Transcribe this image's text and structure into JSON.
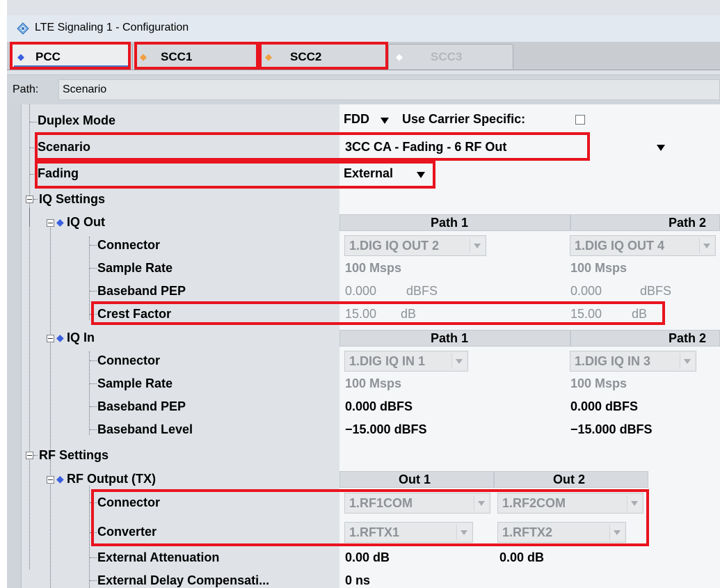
{
  "window": {
    "title": "LTE Signaling 1 - Configuration",
    "icon": "cmw-app-icon"
  },
  "tabs": [
    {
      "label": "PCC",
      "state": "active",
      "dot_color": "#3a5fe0"
    },
    {
      "label": "SCC1",
      "state": "normal",
      "dot_color": "#f0a040"
    },
    {
      "label": "SCC2",
      "state": "normal",
      "dot_color": "#f0a040"
    },
    {
      "label": "SCC3",
      "state": "disabled",
      "dot_color": "#ffffff"
    }
  ],
  "path": {
    "label": "Path:",
    "value": "Scenario"
  },
  "config": {
    "duplex_mode": {
      "label": "Duplex Mode",
      "value": "FDD",
      "use_carrier_label": "Use Carrier Specific:",
      "use_carrier_checked": false
    },
    "scenario": {
      "label": "Scenario",
      "value": "3CC CA - Fading - 6 RF Out"
    },
    "fading": {
      "label": "Fading",
      "value": "External"
    },
    "iq_settings": {
      "label": "IQ Settings",
      "iq_out": {
        "label": "IQ Out",
        "headers": [
          "Path 1",
          "Path 2"
        ],
        "connector": {
          "label": "Connector",
          "values": [
            "1.DIG IQ OUT 2",
            "1.DIG IQ OUT 4"
          ]
        },
        "sample_rate": {
          "label": "Sample Rate",
          "values": [
            "100 Msps",
            "100 Msps"
          ]
        },
        "baseband_pep": {
          "label": "Baseband PEP",
          "values": [
            "0.000",
            "0.000"
          ],
          "unit": "dBFS"
        },
        "crest_factor": {
          "label": "Crest Factor",
          "values": [
            "15.00",
            "15.00"
          ],
          "unit": "dB"
        }
      },
      "iq_in": {
        "label": "IQ In",
        "headers": [
          "Path 1",
          "Path 2"
        ],
        "connector": {
          "label": "Connector",
          "values": [
            "1.DIG IQ IN 1",
            "1.DIG IQ IN 3"
          ]
        },
        "sample_rate": {
          "label": "Sample Rate",
          "values": [
            "100 Msps",
            "100 Msps"
          ]
        },
        "baseband_pep": {
          "label": "Baseband PEP",
          "values": [
            "0.000 dBFS",
            "0.000 dBFS"
          ]
        },
        "baseband_level": {
          "label": "Baseband Level",
          "values": [
            "−15.000 dBFS",
            "−15.000 dBFS"
          ]
        }
      }
    },
    "rf_settings": {
      "label": "RF Settings",
      "rf_output": {
        "label": "RF Output (TX)",
        "headers": [
          "Out 1",
          "Out 2"
        ],
        "connector": {
          "label": "Connector",
          "values": [
            "1.RF1COM",
            "1.RF2COM"
          ]
        },
        "converter": {
          "label": "Converter",
          "values": [
            "1.RFTX1",
            "1.RFTX2"
          ]
        },
        "ext_attenuation": {
          "label": "External Attenuation",
          "values": [
            "0.00 dB",
            "0.00 dB"
          ]
        },
        "ext_delay": {
          "label": "External Delay Compensati...",
          "value": "0 ns"
        }
      }
    }
  },
  "colors": {
    "highlight": "#e8141e",
    "accent": "#4a74c9",
    "pcc_dot": "#3a5fe0",
    "scc_dot": "#f0a040"
  }
}
